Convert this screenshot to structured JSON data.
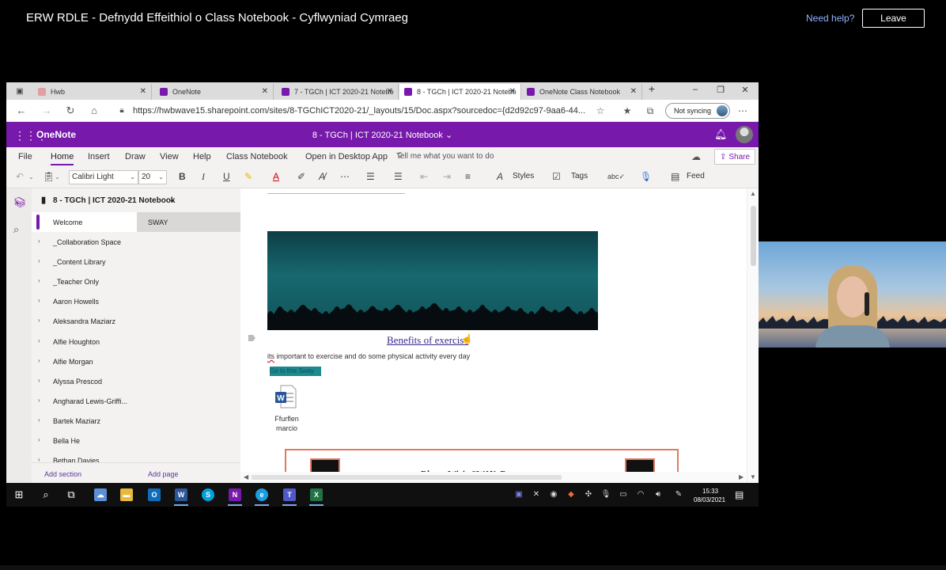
{
  "meeting": {
    "title": "ERW RDLE - Defnydd Effeithiol o Class Notebook - Cyflwyniad Cymraeg",
    "need_help": "Need help?",
    "leave": "Leave"
  },
  "browser": {
    "tabs": [
      {
        "label": "Hwb",
        "fav_color": "#e0a0a0"
      },
      {
        "label": "OneNote",
        "fav_color": "#7719aa"
      },
      {
        "label": "7 - TGCh | ICT 2020-21 Notebo",
        "fav_color": "#7719aa"
      },
      {
        "label": "8 - TGCh | ICT 2020-21 Notebo",
        "fav_color": "#7719aa"
      },
      {
        "label": "OneNote Class Notebook",
        "fav_color": "#7719aa"
      }
    ],
    "url": "https://hwbwave15.sharepoint.com/sites/8-TGChICT2020-21/_layouts/15/Doc.aspx?sourcedoc={d2d92c97-9aa6-44...",
    "sync_label": "Not syncing"
  },
  "onenote": {
    "app_name": "OneNote",
    "notebook_title": "8 - TGCh | ICT 2020-21 Notebook ⌄",
    "ribbon_tabs": [
      "File",
      "Home",
      "Insert",
      "Draw",
      "View",
      "Help",
      "Class Notebook",
      "Open in Desktop App"
    ],
    "tell_me": "Tell me what you want to do",
    "share": "Share",
    "font_name": "Calibri Light",
    "font_size": "20",
    "styles_label": "Styles",
    "tags_label": "Tags",
    "feed_label": "Feed",
    "notebook_name": "8 - TGCh | ICT 2020-21 Notebook",
    "sections": [
      {
        "label": "Welcome",
        "selected": true
      },
      {
        "label": "_Collaboration Space"
      },
      {
        "label": "_Content Library"
      },
      {
        "label": "_Teacher Only"
      },
      {
        "label": "Aaron Howells"
      },
      {
        "label": "Aleksandra Maziarz"
      },
      {
        "label": "Alfie Houghton"
      },
      {
        "label": "Alfie Morgan"
      },
      {
        "label": "Alyssa Prescod"
      },
      {
        "label": "Angharad Lewis-Griffi..."
      },
      {
        "label": "Bartek Maziarz"
      },
      {
        "label": "Bella He"
      },
      {
        "label": "Bethan Davies"
      }
    ],
    "pages": [
      {
        "label": "SWAY"
      }
    ],
    "add_section": "Add section",
    "add_page": "Add page",
    "canvas": {
      "link_title": "Benefits of exercise",
      "body_prefix": "its",
      "body_rest": " important to exercise and do some physical activity every day",
      "highlight_text": "Go to this Sway",
      "file_name_1": "Ffurflen",
      "file_name_2": "marcio",
      "sway_title": "Rhestr Wirio SWAY- Bwynt"
    }
  },
  "taskbar": {
    "time": "15:33",
    "date": "08/03/2021"
  }
}
